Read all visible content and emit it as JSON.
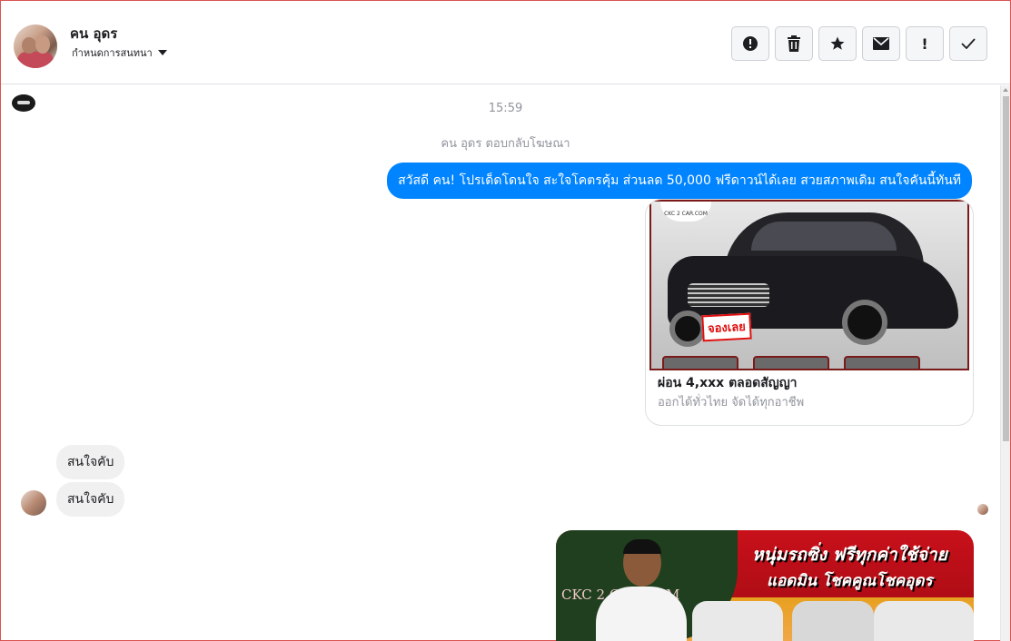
{
  "header": {
    "name": "คน อุดร",
    "subtitle": "กำหนดการสนทนา",
    "toolbar": [
      {
        "icon": "spam-icon",
        "glyph": "!"
      },
      {
        "icon": "trash-icon",
        "glyph": "🗑"
      },
      {
        "icon": "star-icon",
        "glyph": "★"
      },
      {
        "icon": "envelope-icon",
        "glyph": "✉"
      },
      {
        "icon": "exclamation-icon",
        "glyph": "!"
      },
      {
        "icon": "check-icon",
        "glyph": "✓"
      }
    ]
  },
  "chat": {
    "timestamp": "15:59",
    "system_note": "คน อุดร ตอบกลับโฆษณา",
    "outgoing_message": "สวัสดี คน! โปรเด็ดโดนใจ สะใจโคตรคุ้ม ส่วนลด 50,000 ฟรีดาวน์ได้เลย สวยสภาพเดิม สนใจคันนี้ทันที",
    "ad_card": {
      "title": "ผ่อน 4,xxx ตลอดสัญญา",
      "subtitle": "ออกได้ทั่วไทย จัดได้ทุกอาชีพ",
      "image_label": "จองเลย",
      "logo_text": "CKC 2 CAR.COM"
    },
    "incoming": [
      "สนใจคับ",
      "สนใจคับ"
    ],
    "banner": {
      "headline1": "หนุ่มรถซิ่ง ฟรีทุกค่าใช้จ่าย",
      "headline2": "แอดมิน โชคคูณโชคอุดร",
      "logo": "CKC 2 CAR.COM"
    }
  },
  "colors": {
    "accent": "#0084ff",
    "incoming_bubble": "#f1f0f0",
    "border": "#dddfe2"
  }
}
